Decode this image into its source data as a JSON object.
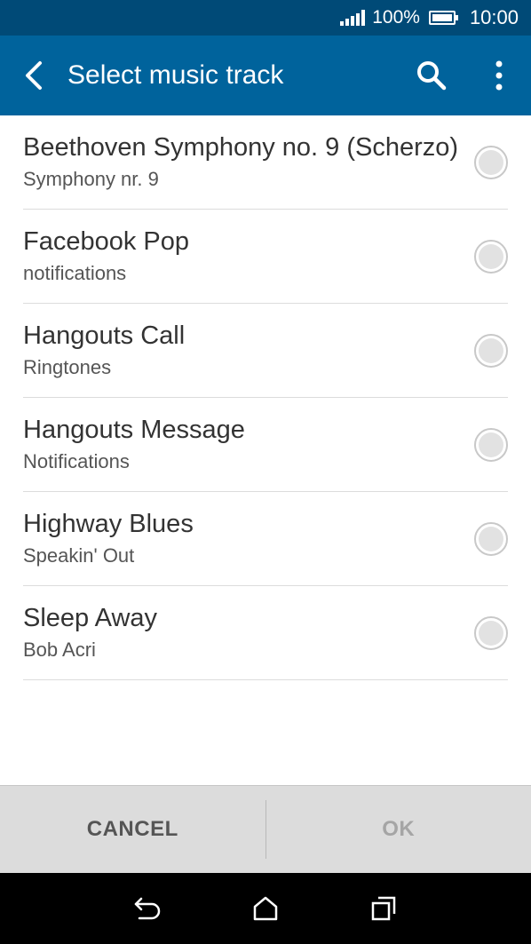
{
  "status_bar": {
    "battery_percent": "100%",
    "time": "10:00"
  },
  "app_bar": {
    "title": "Select music track",
    "icons": [
      "back-arrow-icon",
      "search-icon",
      "more-vert-icon"
    ]
  },
  "tracks": [
    {
      "title": "Beethoven Symphony no. 9 (Scherzo)",
      "subtitle": "Symphony nr. 9"
    },
    {
      "title": "Facebook Pop",
      "subtitle": "notifications"
    },
    {
      "title": "Hangouts Call",
      "subtitle": "Ringtones"
    },
    {
      "title": "Hangouts Message",
      "subtitle": "Notifications"
    },
    {
      "title": "Highway Blues",
      "subtitle": "Speakin' Out"
    },
    {
      "title": "Sleep Away",
      "subtitle": "Bob Acri"
    }
  ],
  "buttons": {
    "cancel": "CANCEL",
    "ok": "OK"
  },
  "colors": {
    "status_bar": "#004a77",
    "app_bar": "#00639c",
    "button_bar": "#dcdcdc"
  }
}
